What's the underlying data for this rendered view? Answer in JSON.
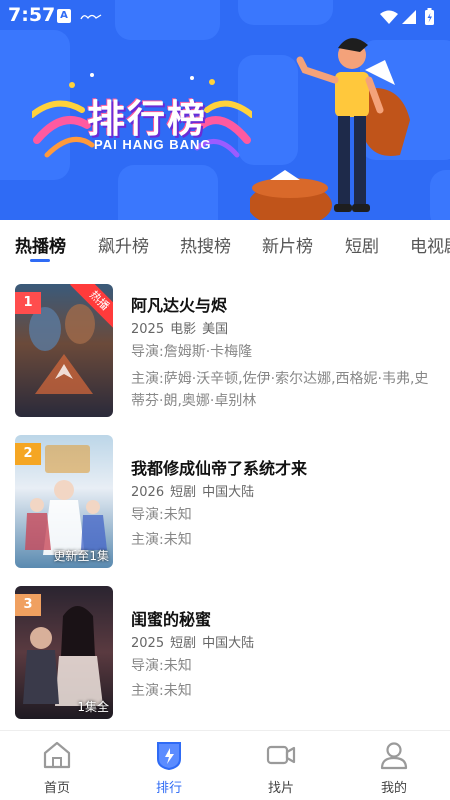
{
  "status_bar": {
    "time": "7:57",
    "app_letter": "A"
  },
  "banner": {
    "title": "排行榜",
    "subtitle": "PAI HANG BANG"
  },
  "tabs": [
    {
      "label": "热播榜",
      "active": true
    },
    {
      "label": "飙升榜"
    },
    {
      "label": "热搜榜"
    },
    {
      "label": "新片榜"
    },
    {
      "label": "短剧"
    },
    {
      "label": "电视剧"
    }
  ],
  "items": [
    {
      "rank": "1",
      "rank_color": "#ff4d4d",
      "badge": "热播",
      "title": "阿凡达火与烬",
      "year": "2025",
      "genre": "电影",
      "region": "美国",
      "director_label": "导演:",
      "director": "詹姆斯·卡梅隆",
      "cast_label": "主演:",
      "cast": "萨姆·沃辛顿,佐伊·索尔达娜,西格妮·韦弗,史蒂芬·朗,奥娜·卓别林"
    },
    {
      "rank": "2",
      "rank_color": "#f5a623",
      "poster_caption": "更新至1集",
      "title": "我都修成仙帝了系统才来",
      "year": "2026",
      "genre": "短剧",
      "region": "中国大陆",
      "director_label": "导演:",
      "director": "未知",
      "cast_label": "主演:",
      "cast": "未知"
    },
    {
      "rank": "3",
      "rank_color": "#f0a060",
      "poster_caption": "1集全",
      "title": "闺蜜的秘蜜",
      "year": "2025",
      "genre": "短剧",
      "region": "中国大陆",
      "director_label": "导演:",
      "director": "未知",
      "cast_label": "主演:",
      "cast": "未知"
    }
  ],
  "bottom_nav": [
    {
      "label": "首页",
      "icon": "home-icon"
    },
    {
      "label": "排行",
      "icon": "ranking-icon",
      "active": true
    },
    {
      "label": "找片",
      "icon": "video-camera-icon"
    },
    {
      "label": "我的",
      "icon": "user-icon"
    }
  ],
  "colors": {
    "accent": "#2f6bf5",
    "banner_bg": "#2f6bf5"
  }
}
